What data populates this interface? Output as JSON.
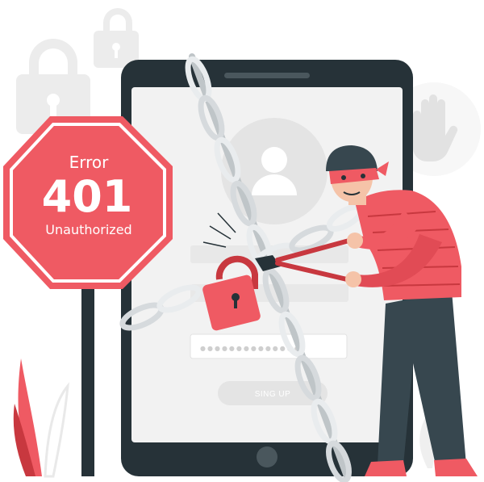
{
  "sign": {
    "line1": "Error",
    "line2": "401",
    "line3": "Unauthorized"
  },
  "phone": {
    "signup_label": "SING UP",
    "password_mask": "●●●●●●●●●●●●●●"
  },
  "colors": {
    "accent": "#ef5a63",
    "accent_dark": "#c8383f",
    "phone_body": "#263238",
    "screen": "#f2f2f2",
    "chain": "#ffffff",
    "background_icons": "#ececec"
  },
  "icons": [
    "padlock-icon",
    "stop-hand-icon",
    "user-avatar-icon",
    "plant-icon"
  ]
}
